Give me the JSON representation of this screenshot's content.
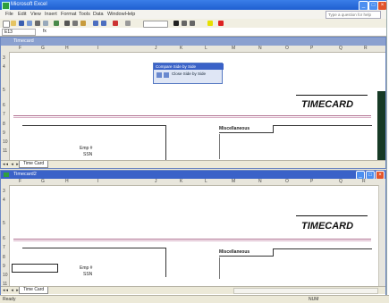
{
  "app": {
    "title": "Microsoft Excel"
  },
  "menu": [
    "File",
    "Edit",
    "View",
    "Insert",
    "Format",
    "Tools",
    "Data",
    "Window",
    "Help"
  ],
  "help_placeholder": "Type a question for help",
  "formula_bar": {
    "name_box": "E13",
    "fx": "fx"
  },
  "top_window": {
    "title": "Timecard",
    "columns": [
      "F",
      "G",
      "H",
      "I",
      "J",
      "K",
      "L",
      "M",
      "N",
      "O",
      "P",
      "Q",
      "R"
    ],
    "rows": [
      "3",
      "4",
      "5",
      "6",
      "7",
      "8",
      "9",
      "10",
      "11"
    ],
    "heading": "TIMECARD",
    "miscellaneous_label": "Miscellaneous",
    "emp_label": "Emp #",
    "ssn_label": "SSN",
    "sheet_tab": "Time Card",
    "floating_toolbar": {
      "title": "Compare Side by Side",
      "close_label": "Close Side by Side"
    }
  },
  "bottom_window": {
    "title": "Timecard2",
    "columns": [
      "F",
      "G",
      "H",
      "I",
      "J",
      "K",
      "L",
      "M",
      "N",
      "O",
      "P",
      "Q",
      "R"
    ],
    "rows": [
      "3",
      "4",
      "5",
      "6",
      "7",
      "8",
      "9",
      "10",
      "11"
    ],
    "heading": "TIMECARD",
    "miscellaneous_label": "Miscellaneous",
    "emp_label": "Emp #",
    "ssn_label": "SSN",
    "sheet_tab": "Time Card"
  },
  "status": {
    "left": "Ready",
    "right": "NUM"
  },
  "colors": {
    "title_blue": "#1f5fd1",
    "accent_pink": "#b07090",
    "window_active": "#3a62c8",
    "window_inactive": "#8aa0cf"
  }
}
